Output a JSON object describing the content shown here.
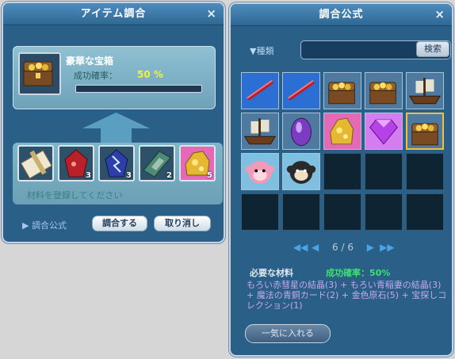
{
  "synthesis_window": {
    "title": "アイテム調合",
    "close": "×",
    "result": {
      "name": "豪華な宝箱",
      "rate_label": "成功確率：",
      "rate_value": "50 %",
      "progress": 0
    },
    "materials": [
      {
        "icon": "scroll-icon",
        "count": ""
      },
      {
        "icon": "red-comet-crystal-icon",
        "count": "3"
      },
      {
        "icon": "blue-lightning-crystal-icon",
        "count": "3"
      },
      {
        "icon": "magic-bronze-card-icon",
        "count": "2"
      },
      {
        "icon": "gold-ore-icon",
        "count": "5"
      }
    ],
    "hint": "材料を登録してください",
    "formula_link": "▶ 調合公式",
    "synthesize_label": "調合する",
    "cancel_label": "取り消し"
  },
  "formula_window": {
    "title": "調合公式",
    "close": "×",
    "category_label": "▼種類",
    "search_value": "",
    "search_button": "検索",
    "grid": [
      [
        "red-staff-icon",
        "red-staff-icon",
        "treasure-chest-icon",
        "treasure-chest-icon",
        "ship-icon"
      ],
      [
        "ship-icon",
        "purple-gem-icon",
        "gold-ore-icon",
        "violet-diamond-icon",
        "treasure-chest-icon"
      ],
      [
        "pink-monkey-icon",
        "black-monkey-icon",
        "",
        "",
        ""
      ],
      [
        "",
        "",
        "",
        "",
        ""
      ]
    ],
    "selected_cell": [
      1,
      4
    ],
    "page": "6 / 6",
    "required_label": "必要な材料",
    "required_rate": "成功確率：50%",
    "required_text": "もろい赤彗星の結晶(3) + もろい青稲妻の結晶(3) + 魔法の青銅カード(2) + 金色原石(5) + 宝探しコレクション(1)",
    "bulk_button": "一気に入れる"
  },
  "colors": {
    "accent": "#2a5f88",
    "rate_green": "#3ee06f",
    "rate_yellow": "#f0f040",
    "requirements": "#c8a8f0"
  }
}
